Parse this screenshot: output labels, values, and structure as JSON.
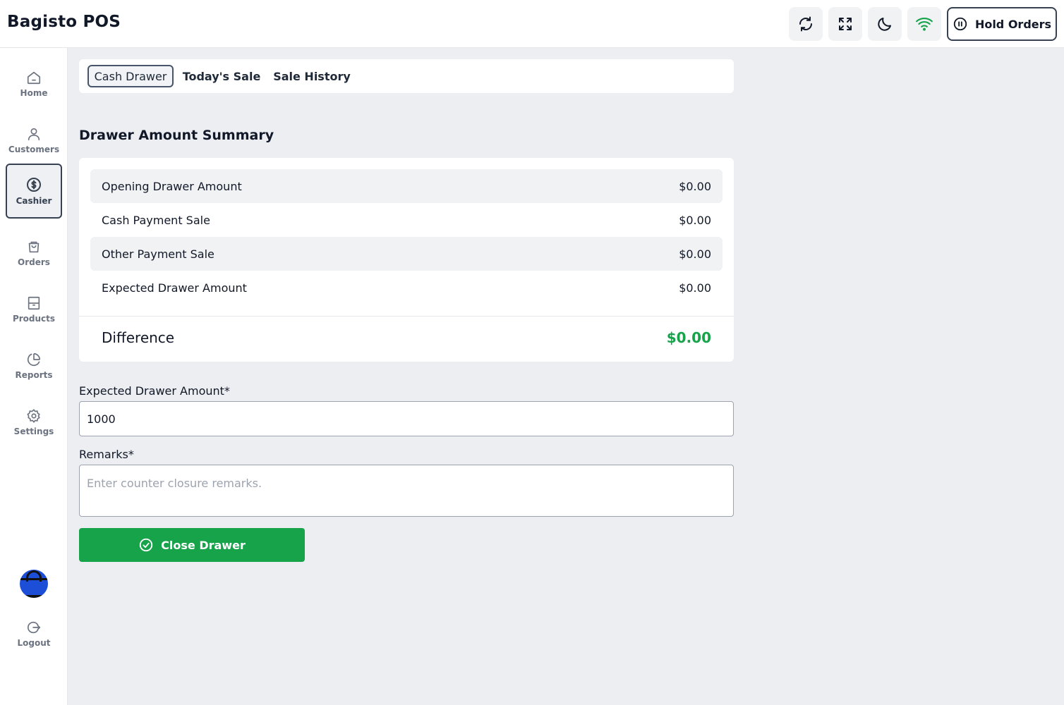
{
  "app": {
    "title": "Bagisto POS"
  },
  "header": {
    "buttons": [
      {
        "icon": "refresh-icon"
      },
      {
        "icon": "fullscreen-icon"
      },
      {
        "icon": "moon-icon"
      },
      {
        "icon": "wifi-icon"
      }
    ],
    "hold_orders_label": "Hold Orders"
  },
  "sidebar": {
    "items": [
      {
        "label": "Home",
        "icon": "home-icon"
      },
      {
        "label": "Customers",
        "icon": "user-icon"
      },
      {
        "label": "Cashier",
        "icon": "dollar-icon",
        "active": true
      },
      {
        "label": "Orders",
        "icon": "shopping-bag-icon"
      },
      {
        "label": "Products",
        "icon": "archive-icon"
      },
      {
        "label": "Reports",
        "icon": "pie-chart-icon"
      },
      {
        "label": "Settings",
        "icon": "gear-icon"
      }
    ],
    "logout_label": "Logout"
  },
  "tabs": [
    {
      "label": "Cash Drawer",
      "active": true
    },
    {
      "label": "Today's Sale"
    },
    {
      "label": "Sale History"
    }
  ],
  "summary": {
    "title": "Drawer Amount Summary",
    "rows": [
      {
        "label": "Opening Drawer Amount",
        "value": "$0.00"
      },
      {
        "label": "Cash Payment Sale",
        "value": "$0.00"
      },
      {
        "label": "Other Payment Sale",
        "value": "$0.00"
      },
      {
        "label": "Expected Drawer Amount",
        "value": "$0.00"
      }
    ],
    "difference_label": "Difference",
    "difference_value": "$0.00"
  },
  "form": {
    "expected_label": "Expected Drawer Amount*",
    "expected_value": "1000",
    "remarks_label": "Remarks*",
    "remarks_placeholder": "Enter counter closure remarks.",
    "close_button_label": "Close Drawer"
  },
  "colors": {
    "accent_green": "#16a34a",
    "wifi_green": "#16a34a",
    "active_border": "#374151"
  }
}
